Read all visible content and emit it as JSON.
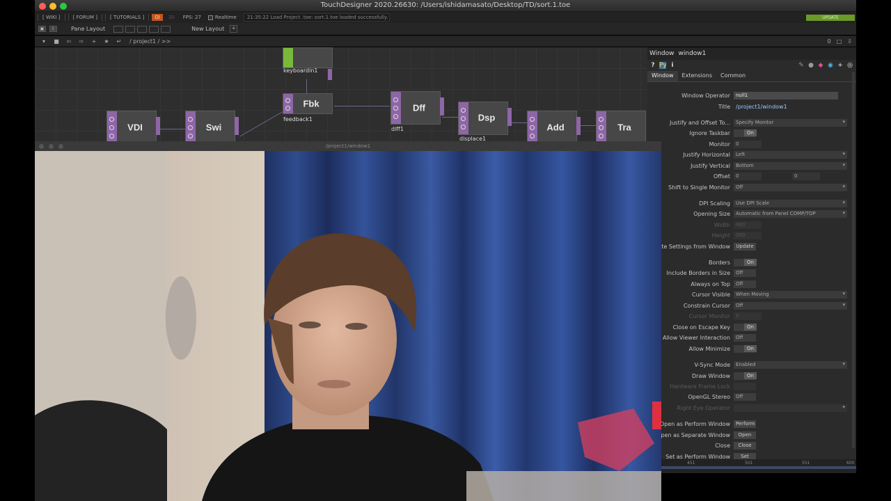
{
  "window": {
    "title": "TouchDesigner 2020.26630: /Users/ishidamasato/Desktop/TD/sort.1.toe"
  },
  "menu": {
    "wiki": "[ WIKI ]",
    "forum": "[ FORUM ]",
    "tutorials": "[ TUTORIALS ]",
    "oi": "OI",
    "num": "30",
    "fps": "FPS:  27",
    "realtime": "Realtime",
    "message": "21:35:22 Load Project .toe: sort.1.toe loaded successfully.",
    "update": "UPDATE"
  },
  "pane": {
    "pane_layout": "Pane Layout",
    "new_layout": "New Layout",
    "plus": "+"
  },
  "path": {
    "text": "/ project1 /  >>",
    "right": [
      "0",
      "□",
      "⇩"
    ]
  },
  "nodes": [
    {
      "id": "keyboardin",
      "label": "",
      "name": "keyboardin1"
    },
    {
      "id": "fbk",
      "label": "Fbk",
      "name": "feedback1"
    },
    {
      "id": "dff",
      "label": "Dff",
      "name": "diff1"
    },
    {
      "id": "dsp",
      "label": "Dsp",
      "name": "displace1"
    },
    {
      "id": "vdi",
      "label": "VDI",
      "name": ""
    },
    {
      "id": "swi",
      "label": "Swi",
      "name": ""
    },
    {
      "id": "add",
      "label": "Add",
      "name": ""
    },
    {
      "id": "tra",
      "label": "Tra",
      "name": ""
    }
  ],
  "params": {
    "op_type": "Window",
    "op_name": "window1",
    "tabs": [
      "Window",
      "Extensions",
      "Common"
    ],
    "active_tab": "Window",
    "rows": [
      {
        "label": "Window Operator",
        "value": "null1",
        "kind": "text"
      },
      {
        "label": "Title",
        "value": "/project1/window1",
        "kind": "plain"
      },
      {
        "label": "Justify and Offset To...",
        "value": "Specify Monitor",
        "kind": "menu"
      },
      {
        "label": "Ignore Taskbar",
        "value": "On",
        "kind": "toggle"
      },
      {
        "label": "Monitor",
        "value": "0",
        "kind": "num"
      },
      {
        "label": "Justify Horizontal",
        "value": "Left",
        "kind": "menu"
      },
      {
        "label": "Justify Vertical",
        "value": "Bottom",
        "kind": "menu"
      },
      {
        "label": "Offset",
        "value": "0",
        "value2": "0",
        "kind": "num2"
      },
      {
        "label": "Shift to Single Monitor",
        "value": "Off",
        "kind": "menu"
      },
      {
        "label": "DPI Scaling",
        "value": "Use DPI Scale",
        "kind": "menu"
      },
      {
        "label": "Opening Size",
        "value": "Automatic from Panel COMP/TOP",
        "kind": "menu"
      },
      {
        "label": "Width",
        "value": "480",
        "kind": "dimnum"
      },
      {
        "label": "Height",
        "value": "300",
        "kind": "dimnum"
      },
      {
        "label": "odate Settings from Window",
        "value": "Update",
        "kind": "btn"
      },
      {
        "label": "Borders",
        "value": "On",
        "kind": "toggle"
      },
      {
        "label": "Include Borders in Size",
        "value": "Off",
        "kind": "off"
      },
      {
        "label": "Always on Top",
        "value": "Off",
        "kind": "off"
      },
      {
        "label": "Cursor Visible",
        "value": "When Moving",
        "kind": "menu"
      },
      {
        "label": "Constrain Cursor",
        "value": "Off",
        "kind": "menu"
      },
      {
        "label": "Cursor Monitor",
        "value": "0",
        "kind": "dimnum"
      },
      {
        "label": "Close on Escape Key",
        "value": "On",
        "kind": "toggle"
      },
      {
        "label": "Allow Viewer Interaction",
        "value": "Off",
        "kind": "off"
      },
      {
        "label": "Allow Minimize",
        "value": "On",
        "kind": "toggle"
      },
      {
        "label": "V-Sync Mode",
        "value": "Enabled",
        "kind": "menu"
      },
      {
        "label": "Draw Window",
        "value": "On",
        "kind": "toggle"
      },
      {
        "label": "Hardware Frame Lock",
        "value": "",
        "kind": "dimoff"
      },
      {
        "label": "OpenGL Stereo",
        "value": "Off",
        "kind": "off"
      },
      {
        "label": "Right Eye Operator",
        "value": "",
        "kind": "dim"
      },
      {
        "label": "Open as Perform Window",
        "value": "Perform",
        "kind": "btn"
      },
      {
        "label": "Open as Separate Window",
        "value": "Open",
        "kind": "btn"
      },
      {
        "label": "Close",
        "value": "Close",
        "kind": "btn"
      },
      {
        "label": "Set as Perform Window",
        "value": "Set",
        "kind": "btn"
      }
    ]
  },
  "timeline": {
    "ticks": [
      "451",
      "501",
      "551",
      "600"
    ]
  },
  "viewer": {
    "title": "/project1/window1"
  }
}
